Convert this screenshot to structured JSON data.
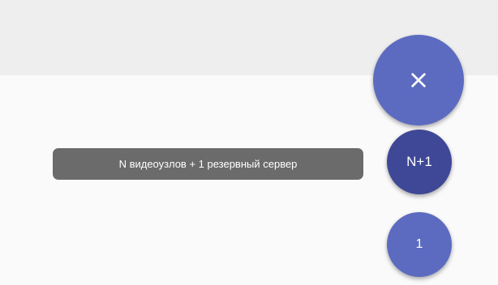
{
  "speed_dial": {
    "main_button": {
      "icon": "close-icon",
      "color": "#5c6bc0"
    },
    "actions": [
      {
        "label": "N+1",
        "tooltip": "N видеоузлов + 1 резервный сервер",
        "color": "#3f4896"
      },
      {
        "label": "1",
        "color": "#5c6bc0"
      }
    ]
  }
}
